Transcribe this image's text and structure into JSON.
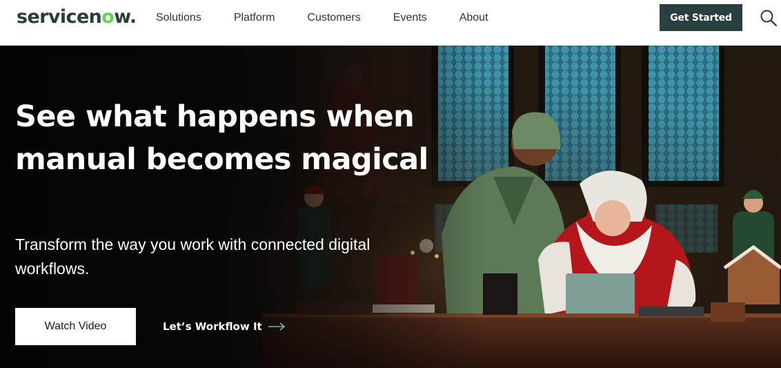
{
  "header": {
    "logo": {
      "text_main": "servicen",
      "text_accent": "o",
      "text_tail": "w."
    },
    "nav": [
      {
        "label": "Solutions"
      },
      {
        "label": "Platform"
      },
      {
        "label": "Customers"
      },
      {
        "label": "Events"
      },
      {
        "label": "About"
      }
    ],
    "cta_label": "Get Started",
    "search_icon": "search-icon"
  },
  "hero": {
    "headline": "See what happens when manual becomes magical",
    "subheadline": "Transform the way you work with connected digital workflows.",
    "primary_button": "Watch Video",
    "secondary_link": "Let’s Workflow It",
    "secondary_icon": "arrow-right-icon",
    "background_image": "santa-and-elf-in-workshop"
  },
  "colors": {
    "brand_dark": "#293e40",
    "brand_green": "#62d84e",
    "arrow_green": "#81b5a1",
    "hero_text": "#ffffff"
  }
}
